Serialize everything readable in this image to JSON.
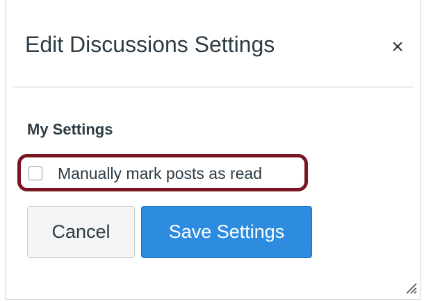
{
  "dialog": {
    "title": "Edit Discussions Settings",
    "close_glyph": "×",
    "close_icon": "close-icon",
    "resize_icon": "resize-grip-icon"
  },
  "my_settings": {
    "heading": "My Settings",
    "manual_mark_read": {
      "label": "Manually mark posts as read",
      "checked": false
    }
  },
  "buttons": {
    "cancel_label": "Cancel",
    "save_label": "Save Settings"
  },
  "colors": {
    "primary_button": "#2d8ce0",
    "highlight_outline": "#7a1420",
    "text": "#2d3b45"
  }
}
